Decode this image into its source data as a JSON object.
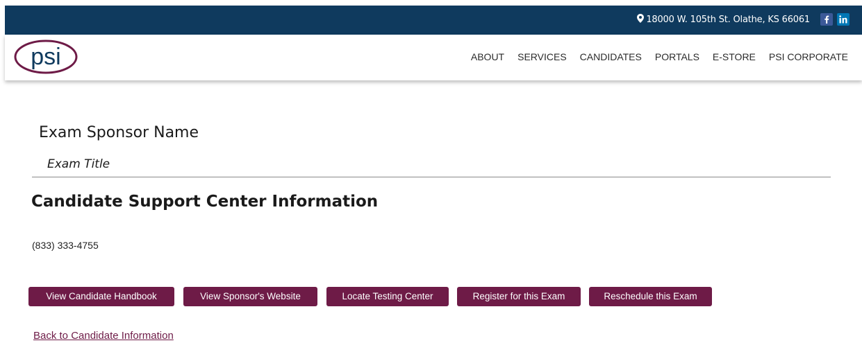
{
  "topbar": {
    "address": "18000 W. 105th St. Olathe, KS 66061",
    "icons": [
      "map-pin-icon",
      "facebook-icon",
      "linkedin-icon"
    ],
    "colors": {
      "background": "#0f3a5e",
      "facebook": "#3b5998",
      "linkedin": "#0077b5"
    }
  },
  "header": {
    "logo_text": "psi",
    "nav": [
      "ABOUT",
      "SERVICES",
      "CANDIDATES",
      "PORTALS",
      "E-STORE",
      "PSI CORPORATE"
    ]
  },
  "main": {
    "sponsor_name": "Exam Sponsor Name",
    "exam_title": "Exam Title",
    "section_title": "Candidate Support Center Information",
    "phone": "(833) 333-4755",
    "buttons": [
      "View Candidate Handbook",
      "View Sponsor's Website",
      "Locate Testing Center",
      "Register for this Exam",
      "Reschedule this Exam"
    ],
    "back_link": "Back to Candidate Information"
  },
  "colors": {
    "accent": "#6e1b47",
    "divider": "#8a8a8a"
  }
}
